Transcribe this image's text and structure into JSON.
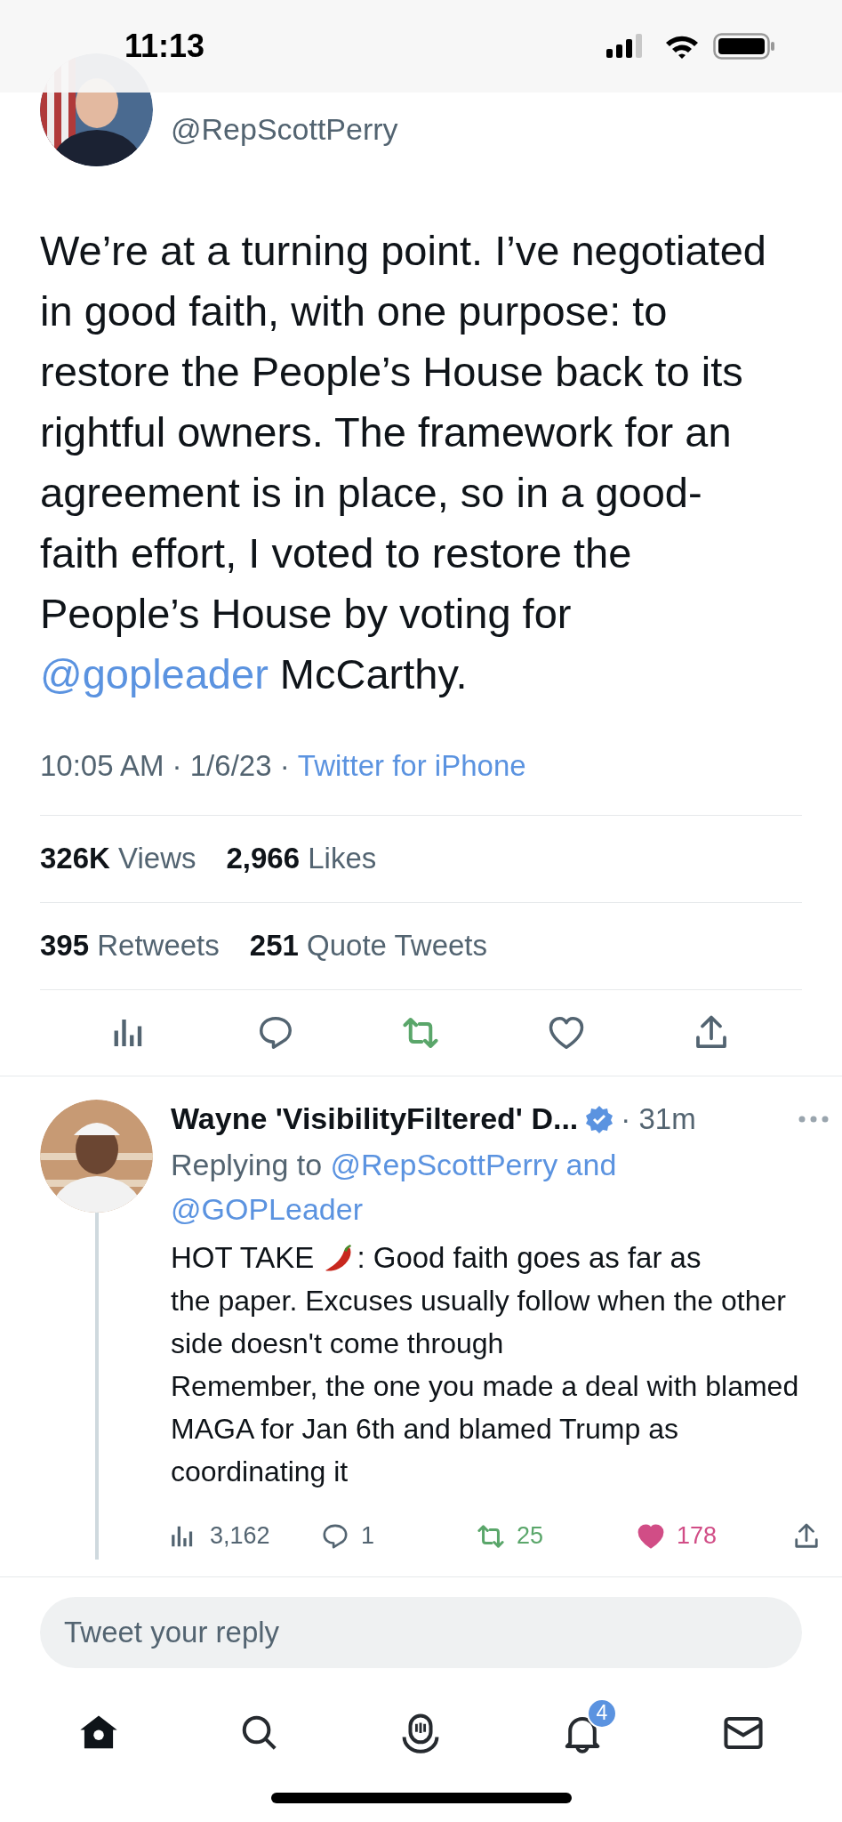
{
  "status_bar": {
    "time": "11:13"
  },
  "tweet": {
    "handle": "@RepScottPerry",
    "text": [
      {
        "kind": "plain",
        "text": "We’re at a turning point. I’ve negotiated in good faith, with one purpose: to restore the People’s House back to its rightful owners. The framework for an agreement is in place, so in a good-faith effort, I voted to restore the People’s House by voting for "
      },
      {
        "kind": "mention",
        "text": "@gopleader"
      },
      {
        "kind": "plain",
        "text": " McCarthy."
      }
    ],
    "meta": "10:05 AM · 1/6/23 · ",
    "source": "Twitter for iPhone",
    "stats": [
      [
        "**326K** Views",
        "**2,966** Likes"
      ],
      [
        "**395** Retweets",
        "**251** Quote Tweets"
      ]
    ],
    "actions": [
      {
        "kind": "views",
        "on": false
      },
      {
        "kind": "reply",
        "on": false
      },
      {
        "kind": "retweet",
        "on": true
      },
      {
        "kind": "like",
        "on": false
      },
      {
        "kind": "share",
        "on": false
      }
    ]
  },
  "reply": {
    "name": "Wayne 'VisibilityFiltered' D...",
    "verified": true,
    "time": "· 31m",
    "replying_to": [
      {
        "kind": "plain",
        "text": "Replying to "
      },
      {
        "kind": "mention",
        "text": "@RepScottPerry"
      },
      {
        "kind": "blue",
        "text": " and "
      },
      {
        "kind": "mention",
        "text": "@GOPLeader"
      }
    ],
    "text_before": "HOT TAKE",
    "text_line1": ": Good faith goes as far as",
    "text_rest": "the paper. Excuses usually follow when the other side doesn't come through\nRemember, the one you made a deal with blamed MAGA for Jan 6th and blamed Trump as coordinating it",
    "actions": [
      {
        "kind": "views",
        "count": "3,162",
        "on": false
      },
      {
        "kind": "reply",
        "count": "1",
        "on": false
      },
      {
        "kind": "retweet",
        "count": "25",
        "on": true
      },
      {
        "kind": "like",
        "count": "178",
        "on": true
      },
      {
        "kind": "share",
        "on": false
      }
    ]
  },
  "compose": {
    "placeholder": "Tweet your reply"
  },
  "nav": [
    {
      "kind": "home",
      "selected": true
    },
    {
      "kind": "search",
      "selected": false
    },
    {
      "kind": "spaces",
      "selected": false
    },
    {
      "kind": "notifications",
      "selected": false,
      "badge": "4"
    },
    {
      "kind": "messages",
      "selected": false
    }
  ]
}
